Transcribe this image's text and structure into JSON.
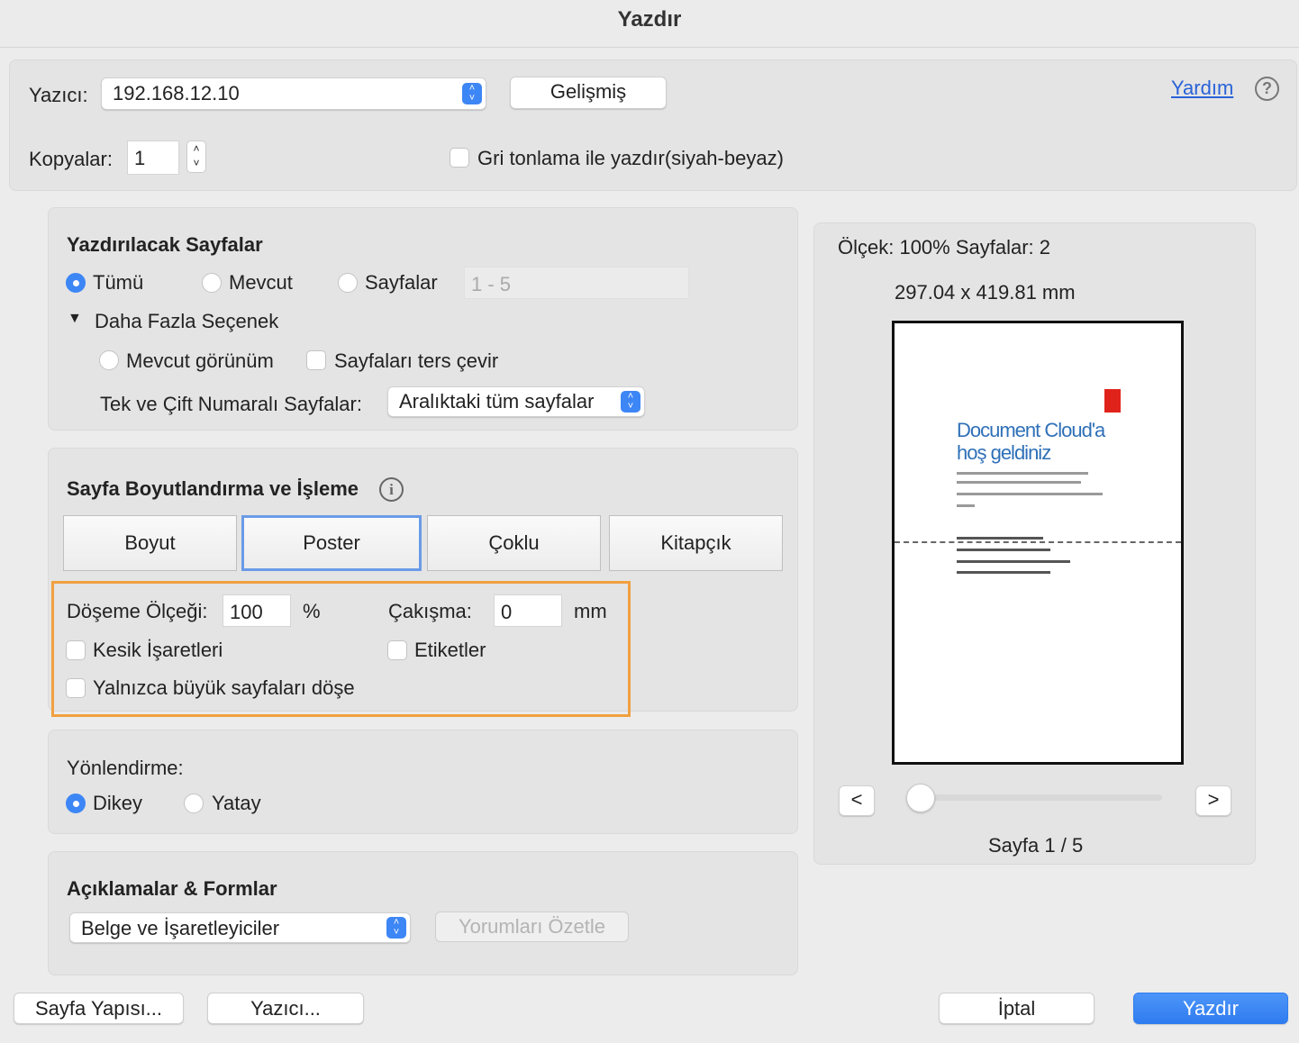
{
  "window": {
    "title": "Yazdır"
  },
  "printer": {
    "label": "Yazıcı:",
    "value": "192.168.12.10",
    "advanced": "Gelişmiş",
    "help": "Yardım",
    "copies_label": "Kopyalar:",
    "copies": "1",
    "grayscale": "Gri tonlama ile yazdır(siyah-beyaz)",
    "grayscale_checked": false
  },
  "pages": {
    "title": "Yazdırılacak Sayfalar",
    "all": "Tümü",
    "current": "Mevcut",
    "pages": "Sayfalar",
    "range_placeholder": "1 - 5",
    "selected": "all",
    "more": "Daha Fazla Seçenek",
    "current_view": "Mevcut görünüm",
    "reverse": "Sayfaları ters çevir",
    "odd_even_label": "Tek ve Çift Numaralı Sayfalar:",
    "odd_even_value": "Aralıktaki tüm sayfalar"
  },
  "sizing": {
    "title": "Sayfa Boyutlandırma ve İşleme",
    "tabs": [
      "Boyut",
      "Poster",
      "Çoklu",
      "Kitapçık"
    ],
    "active_tab": "Poster",
    "tile_scale_label": "Döşeme Ölçeği:",
    "tile_scale": "100",
    "percent": "%",
    "overlap_label": "Çakışma:",
    "overlap": "0",
    "overlap_unit": "mm",
    "cut_marks": "Kesik İşaretleri",
    "labels": "Etiketler",
    "large_only": "Yalnızca büyük sayfaları döşe",
    "highlight_color": "#f0a040"
  },
  "orientation": {
    "title": "Yönlendirme:",
    "portrait": "Dikey",
    "landscape": "Yatay",
    "selected": "portrait"
  },
  "comments": {
    "title": "Açıklamalar & Formlar",
    "value": "Belge ve İşaretleyiciler",
    "summarize": "Yorumları Özetle"
  },
  "preview": {
    "scale": "Ölçek: 100% Sayfalar: 2",
    "size": "297.04 x 419.81 mm",
    "doc_title_1": "Document Cloud'a",
    "doc_title_2": "hoş geldiniz",
    "prev": "<",
    "next": ">",
    "page": "Sayfa 1 / 5",
    "slider_fraction": 0
  },
  "footer": {
    "page_setup": "Sayfa Yapısı...",
    "printer": "Yazıcı...",
    "cancel": "İptal",
    "print": "Yazdır"
  }
}
